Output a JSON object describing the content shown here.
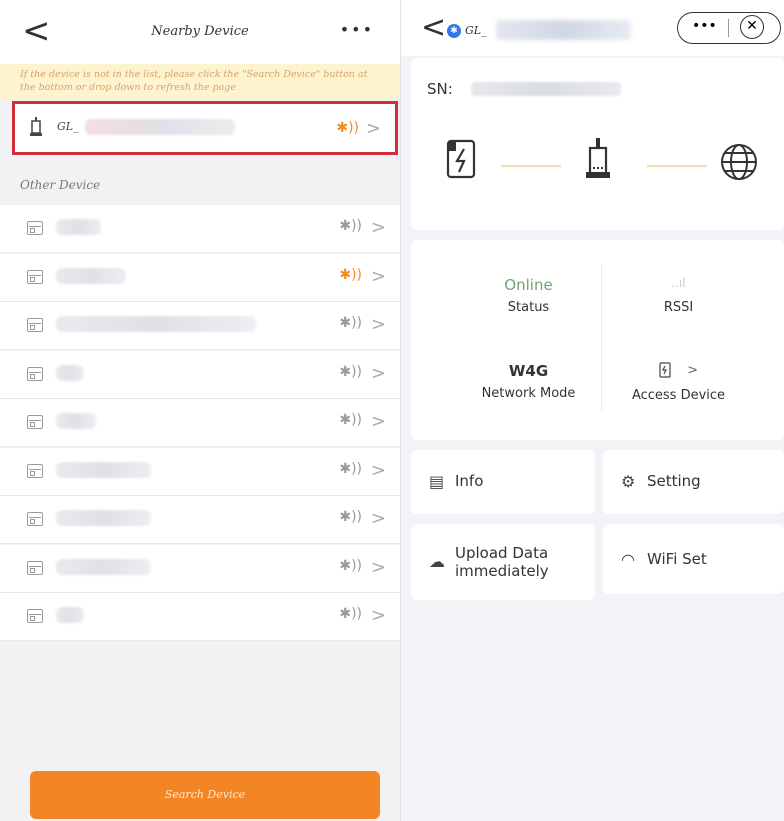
{
  "nearby": {
    "back_glyph": "<",
    "title": "Nearby Device",
    "more_glyph": "•••",
    "notice": "If the device is not in the list, please click the \"Search Device\" button at the bottom or drop down to refresh the page",
    "selected": {
      "name": "GL_",
      "bt_glyph": "✱))",
      "chevron": ">"
    },
    "section_title": "Other Device",
    "other_devices": [
      {
        "active": false
      },
      {
        "active": true
      },
      {
        "active": false
      },
      {
        "active": false
      },
      {
        "active": false
      },
      {
        "active": false
      },
      {
        "active": false
      },
      {
        "active": false
      },
      {
        "active": false
      }
    ],
    "bt_glyph": "✱))",
    "chevron": ">",
    "search_button": "Search Device"
  },
  "detail": {
    "back_glyph": "<",
    "bt_badge": "✱",
    "name": "GL_",
    "capsule_more": "•••",
    "capsule_close": "✕",
    "sn_label": "SN:",
    "status_value": "Online",
    "status_label": "Status",
    "rssi_glyph": "..ıl",
    "rssi_label": "RSSI",
    "network_value": "W4G",
    "network_label": "Network Mode",
    "access_chevron": ">",
    "access_label": "Access Device",
    "tiles": {
      "info": "Info",
      "setting": "Setting",
      "upload": "Upload Data immediately",
      "wifi": "WiFi Set"
    }
  },
  "colors": {
    "accent": "#f28524",
    "online": "#6aa96a",
    "highlight": "#d42e3a",
    "bt_blue": "#2e79e6"
  }
}
